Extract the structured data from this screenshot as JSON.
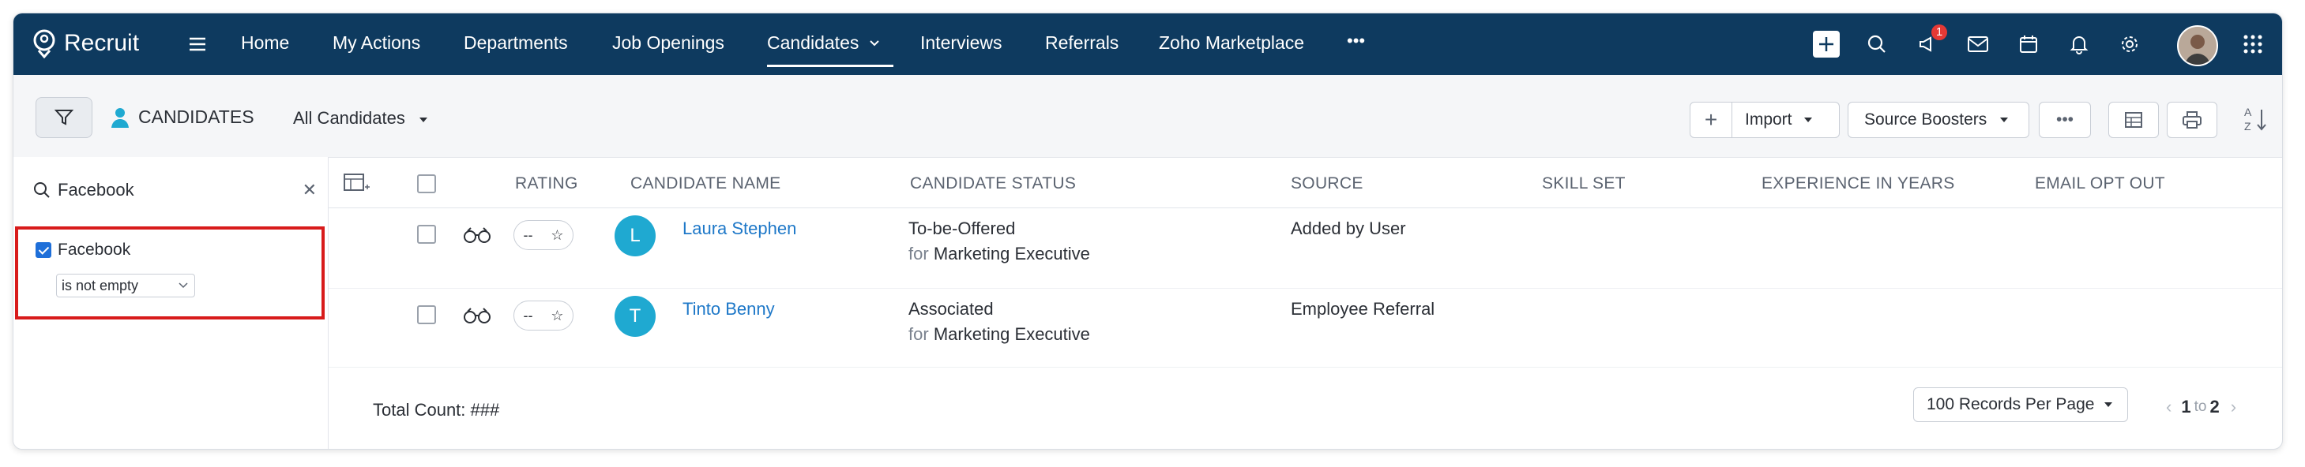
{
  "app": {
    "name": "Recruit"
  },
  "nav": {
    "items": [
      {
        "label": "Home"
      },
      {
        "label": "My Actions"
      },
      {
        "label": "Departments"
      },
      {
        "label": "Job Openings"
      },
      {
        "label": "Candidates"
      },
      {
        "label": "Interviews"
      },
      {
        "label": "Referrals"
      },
      {
        "label": "Zoho Marketplace"
      }
    ],
    "more_label": "•••",
    "notification_count": "1"
  },
  "toolbar": {
    "module_title": "CANDIDATES",
    "view_name": "All Candidates",
    "add_label": "+",
    "import_label": "Import",
    "source_boosters_label": "Source Boosters",
    "more_label": "•••"
  },
  "sidebar": {
    "search_value": "Facebook",
    "clear_label": "✕",
    "filter_field": "Facebook",
    "filter_condition": "is not empty"
  },
  "table": {
    "headers": {
      "rating": "RATING",
      "name": "CANDIDATE NAME",
      "status": "CANDIDATE STATUS",
      "source": "SOURCE",
      "skill": "SKILL SET",
      "experience": "EXPERIENCE IN YEARS",
      "email_opt": "EMAIL OPT OUT"
    },
    "rows": [
      {
        "initial": "L",
        "name": "Laura Stephen",
        "rating": "--",
        "status": "To-be-Offered",
        "for_label": "for",
        "job": "Marketing Executive",
        "source": "Added by User"
      },
      {
        "initial": "T",
        "name": "Tinto Benny",
        "rating": "--",
        "status": "Associated",
        "for_label": "for",
        "job": "Marketing Executive",
        "source": "Employee Referral"
      }
    ]
  },
  "footer": {
    "total_label": "Total Count: ###",
    "per_page": "100 Records Per Page",
    "page_from": "1",
    "page_to_label": "to",
    "page_to": "2"
  },
  "colors": {
    "nav_bg": "#0e3a5f",
    "highlight": "#d81b1b",
    "link": "#1e78c8",
    "avatar": "#1fa9d1"
  }
}
